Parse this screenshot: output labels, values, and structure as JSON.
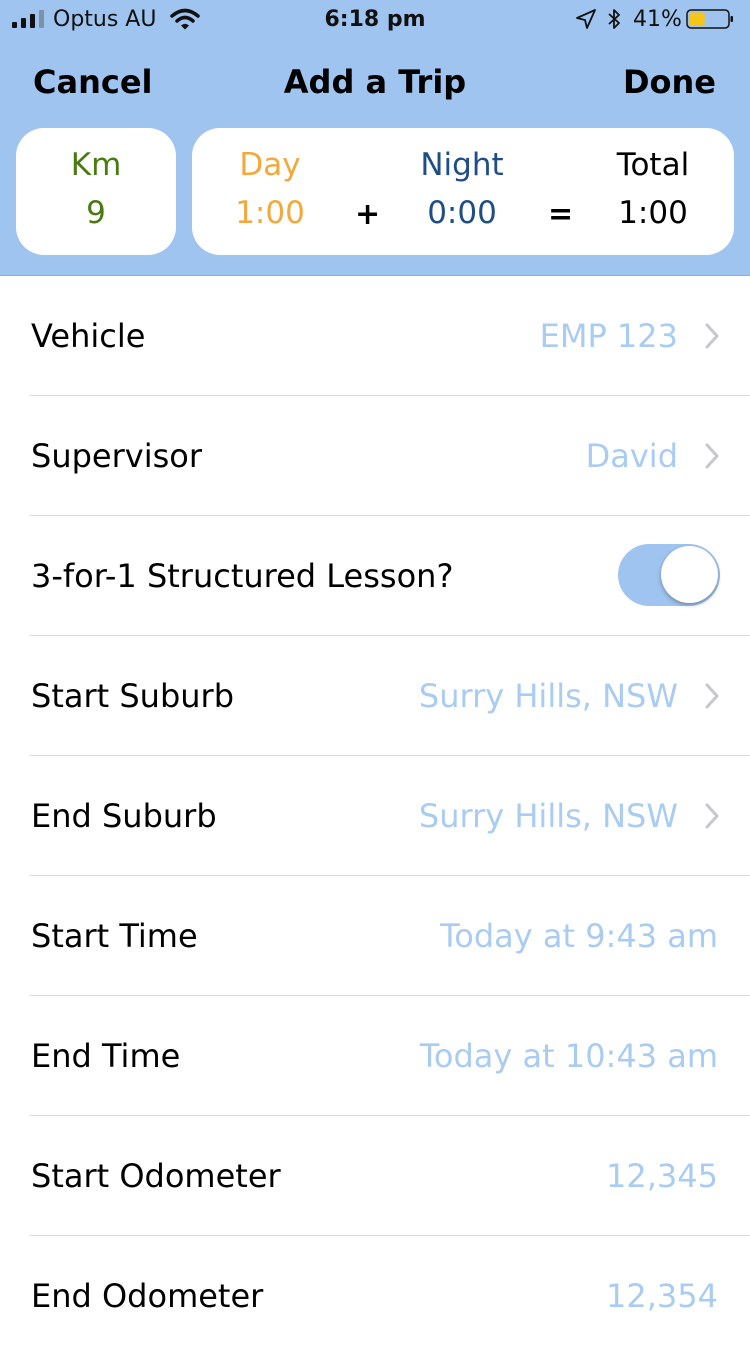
{
  "status_bar": {
    "carrier": "Optus AU",
    "time": "6:18 pm",
    "battery_pct": "41%",
    "battery_level": 0.41,
    "icons": [
      "signal-icon",
      "wifi-icon",
      "location-arrow-icon",
      "bluetooth-icon",
      "battery-icon"
    ]
  },
  "nav": {
    "cancel_label": "Cancel",
    "title": "Add a Trip",
    "done_label": "Done"
  },
  "summary": {
    "km_label": "Km",
    "km_value": "9",
    "day_label": "Day",
    "day_value": "1:00",
    "plus": "+",
    "night_label": "Night",
    "night_value": "0:00",
    "equals": "=",
    "total_label": "Total",
    "total_value": "1:00"
  },
  "colors": {
    "header_bg": "#9fc4ef",
    "km": "#4c7a12",
    "day": "#f3a83a",
    "night": "#1f4d86",
    "value_text": "#a9ccf2",
    "chevron": "#c7c7cc"
  },
  "rows": [
    {
      "label": "Vehicle",
      "value": "EMP 123",
      "accessory": "chevron-right-icon"
    },
    {
      "label": "Supervisor",
      "value": "David",
      "accessory": "chevron-right-icon"
    },
    {
      "label": "3-for-1 Structured Lesson?",
      "toggle_on": true
    },
    {
      "label": "Start Suburb",
      "value": "Surry Hills, NSW",
      "accessory": "chevron-right-icon"
    },
    {
      "label": "End Suburb",
      "value": "Surry Hills, NSW",
      "accessory": "chevron-right-icon"
    },
    {
      "label": "Start Time",
      "value": "Today at 9:43 am"
    },
    {
      "label": "End Time",
      "value": "Today at 10:43 am"
    },
    {
      "label": "Start Odometer",
      "value": "12,345"
    },
    {
      "label": "End Odometer",
      "value": "12,354"
    }
  ]
}
